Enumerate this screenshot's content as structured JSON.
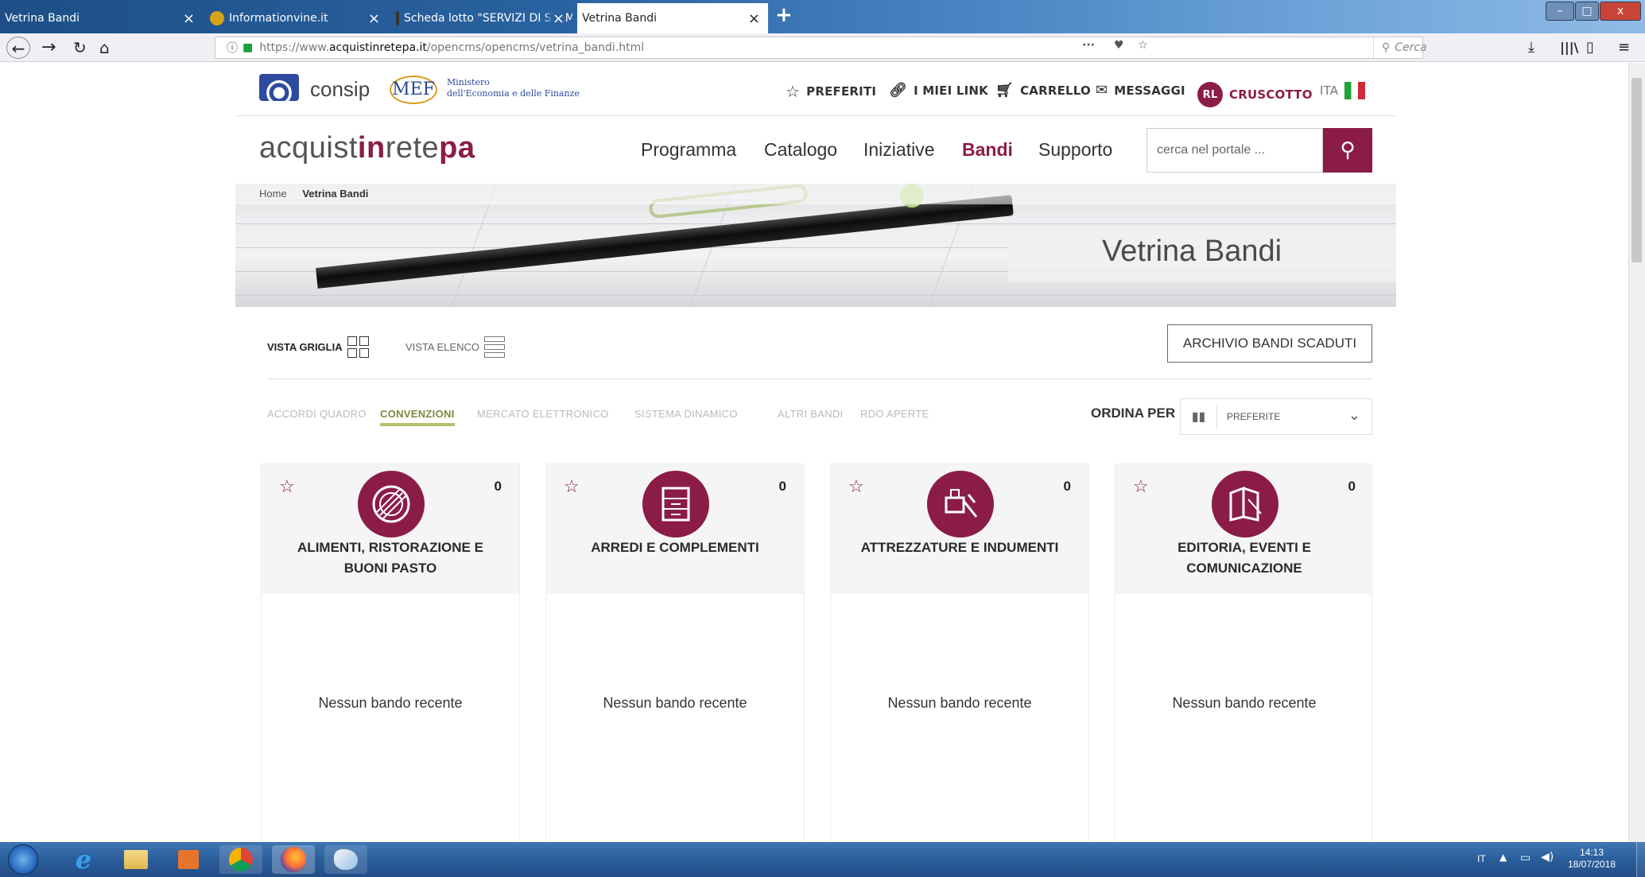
{
  "browser": {
    "tabs": [
      {
        "title": "Vetrina Bandi",
        "active": false
      },
      {
        "title": "Informationvine.it",
        "active": false
      },
      {
        "title": "Scheda lotto \"SERVIZI DI STAM",
        "active": false
      },
      {
        "title": "Vetrina Bandi",
        "active": true
      }
    ],
    "new_tab_label": "+",
    "url": {
      "prefix": "https://www.",
      "domain": "acquistinretepa.it",
      "path": "/opencms/opencms/vetrina_bandi.html"
    },
    "search_placeholder": "Cerca",
    "page_actions": "···",
    "window_controls": {
      "minimize": "–",
      "maximize": "□",
      "close": "x"
    }
  },
  "site": {
    "logos": {
      "consip": "consip",
      "mef": "MEF",
      "mef_line1": "Ministero",
      "mef_line2": "dell'Economia e delle Finanze"
    },
    "top_links": {
      "preferiti": "PREFERITI",
      "miei_link": "I MIEI LINK",
      "carrello": "CARRELLO",
      "messaggi": "MESSAGGI",
      "avatar_initials": "RL",
      "cruscotto": "CRUSCOTTO",
      "lang": "ITA"
    },
    "brand": {
      "part1": "acquist",
      "part2": "in",
      "part3": "rete",
      "part4": "pa"
    },
    "main_nav": [
      "Programma",
      "Catalogo",
      "Iniziative",
      "Bandi",
      "Supporto"
    ],
    "active_nav": "Bandi",
    "search_placeholder": "cerca nel portale ...",
    "breadcrumb": {
      "home": "Home",
      "current": "Vetrina Bandi"
    },
    "hero_title": "Vetrina Bandi",
    "view_grid": "VISTA GRIGLIA",
    "view_list": "VISTA ELENCO",
    "archive_button": "ARCHIVIO BANDI SCADUTI",
    "filters": [
      "ACCORDI QUADRO",
      "CONVENZIONI",
      "MERCATO ELETTRONICO",
      "SISTEMA DINAMICO",
      "ALTRI BANDI",
      "RDO APERTE"
    ],
    "active_filter": "CONVENZIONI",
    "sort_label": "ORDINA PER",
    "sort_value": "PREFERITE",
    "cards": [
      {
        "title_line1": "ALIMENTI, RISTORAZIONE E",
        "title_line2": "BUONI PASTO",
        "count": "0",
        "empty": "Nessun bando recente",
        "icon": "food-icon"
      },
      {
        "title_line1": "ARREDI E COMPLEMENTI",
        "title_line2": "",
        "count": "0",
        "empty": "Nessun bando recente",
        "icon": "drawer-icon"
      },
      {
        "title_line1": "ATTREZZATURE E INDUMENTI",
        "title_line2": "",
        "count": "0",
        "empty": "Nessun bando recente",
        "icon": "tools-icon"
      },
      {
        "title_line1": "EDITORIA, EVENTI E",
        "title_line2": "COMUNICAZIONE",
        "count": "0",
        "empty": "Nessun bando recente",
        "icon": "book-icon"
      }
    ]
  },
  "taskbar": {
    "lang": "IT",
    "time": "14:13",
    "date": "18/07/2018"
  },
  "colors": {
    "brand": "#8b1c48",
    "accent_underline": "#b5c26b"
  }
}
